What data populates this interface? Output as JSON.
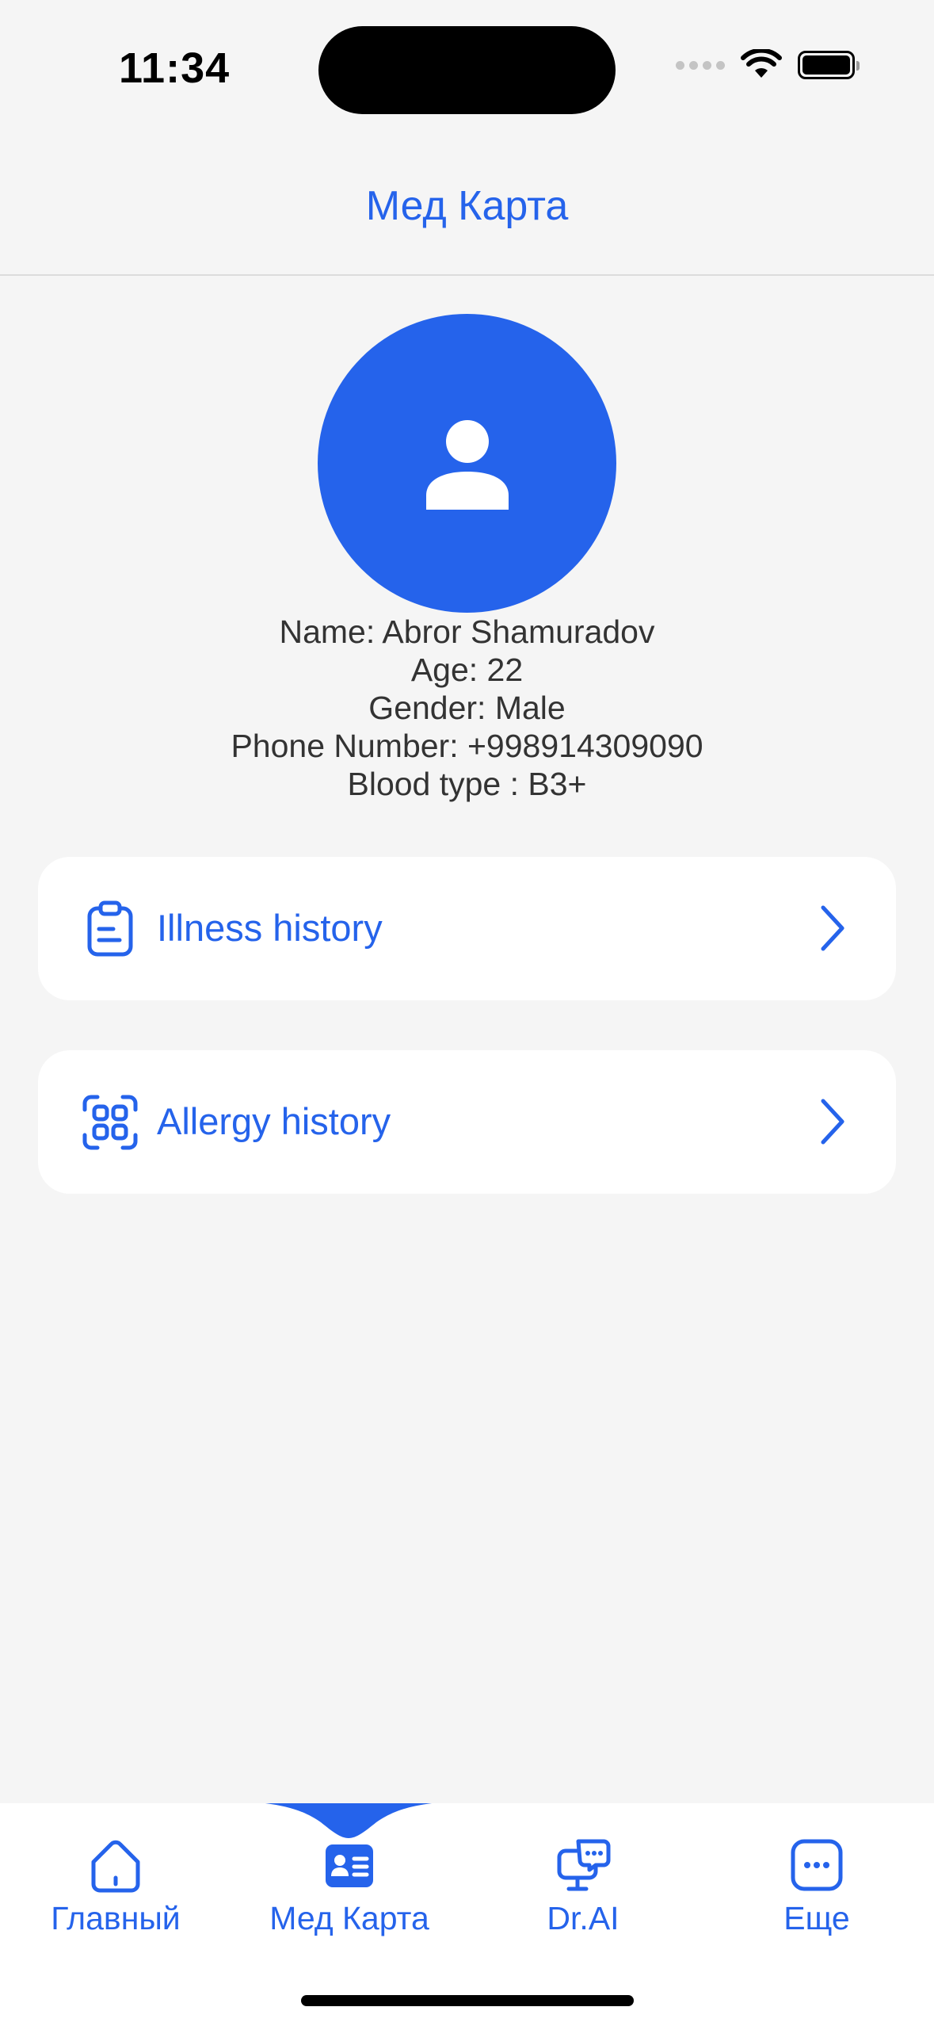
{
  "status_bar": {
    "time": "11:34"
  },
  "header": {
    "title": "Мед Карта"
  },
  "profile": {
    "name_line": "Name: Abror Shamuradov",
    "age_line": "Age: 22",
    "gender_line": "Gender: Male",
    "phone_line": "Phone Number: +998914309090",
    "blood_line": "Blood type : B3+"
  },
  "cards": [
    {
      "label": "Illness history",
      "icon": "clipboard-icon"
    },
    {
      "label": "Allergy history",
      "icon": "scan-grid-icon"
    }
  ],
  "tabbar": {
    "tabs": [
      {
        "label": "Главный",
        "icon": "home-icon"
      },
      {
        "label": "Мед Карта",
        "icon": "id-card-icon",
        "active": true
      },
      {
        "label": "Dr.AI",
        "icon": "chat-monitor-icon"
      },
      {
        "label": "Еще",
        "icon": "more-icon"
      }
    ]
  },
  "colors": {
    "accent": "#2563EB",
    "background": "#F5F5F5",
    "card": "#FFFFFF",
    "text": "#333333"
  }
}
